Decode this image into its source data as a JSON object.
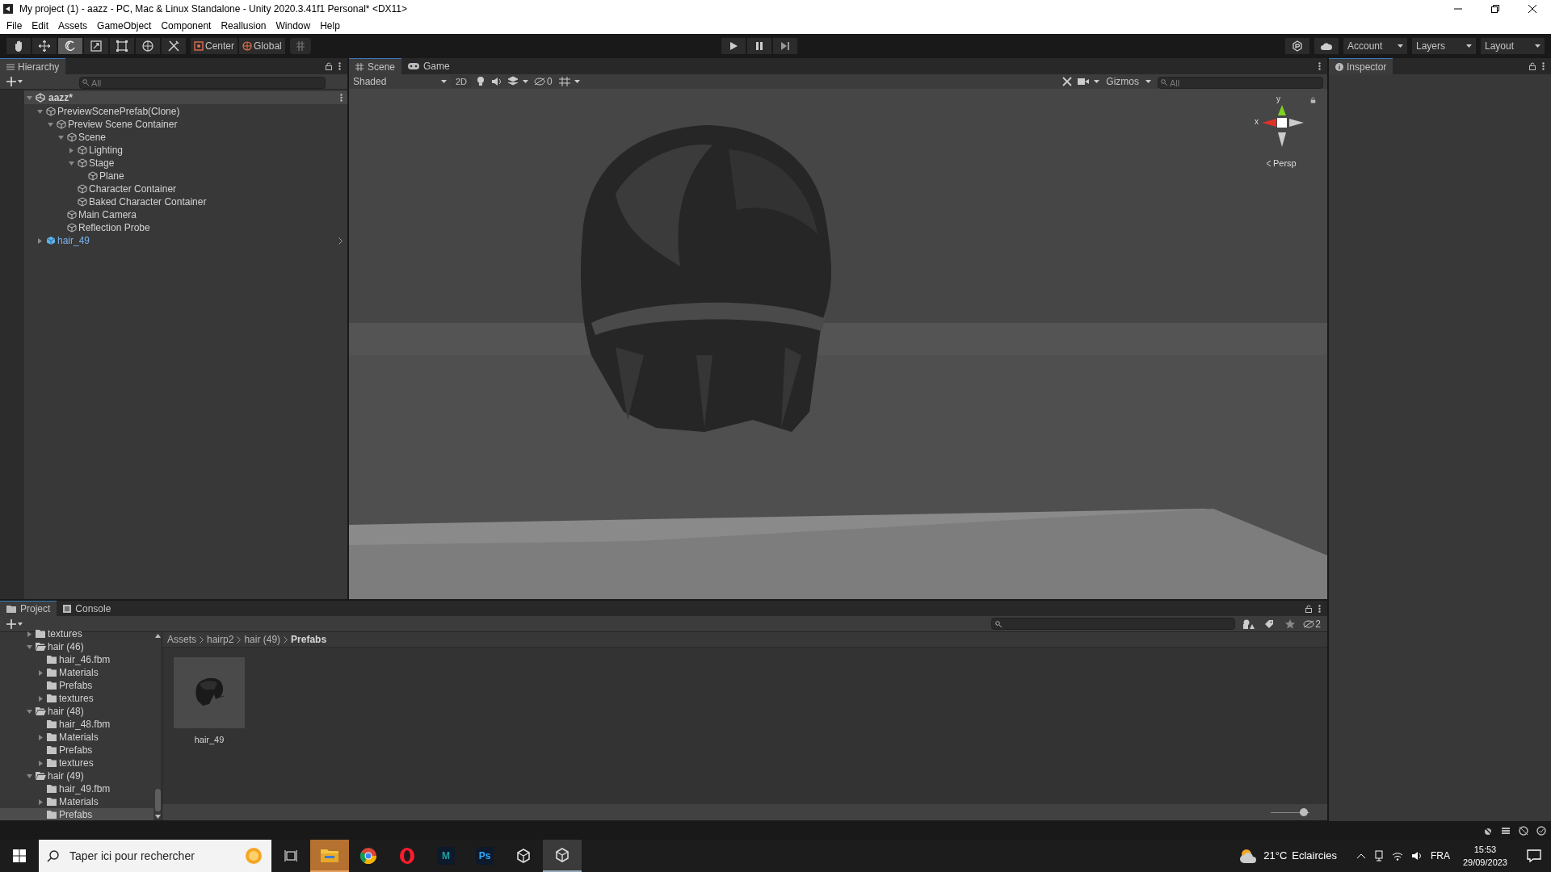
{
  "window": {
    "title": "My project (1) - aazz - PC, Mac & Linux Standalone - Unity 2020.3.41f1 Personal* <DX11>"
  },
  "menu": [
    "File",
    "Edit",
    "Assets",
    "GameObject",
    "Component",
    "Reallusion",
    "Window",
    "Help"
  ],
  "toolbar": {
    "tools": [
      {
        "kind": "hand",
        "selected": false
      },
      {
        "kind": "move",
        "selected": false
      },
      {
        "kind": "rotate",
        "selected": true
      },
      {
        "kind": "scale",
        "selected": false
      },
      {
        "kind": "rect",
        "selected": false
      },
      {
        "kind": "transform",
        "selected": false
      },
      {
        "kind": "custom",
        "selected": false
      }
    ],
    "pivot": [
      {
        "kind": "center",
        "label": "Center"
      },
      {
        "kind": "global",
        "label": "Global"
      }
    ],
    "right": [
      "Account",
      "Layers",
      "Layout"
    ]
  },
  "hierarchy": {
    "tab": "Hierarchy",
    "search": {
      "placeholder": "All"
    },
    "tree": [
      {
        "kind": "scene",
        "label": "aazz*",
        "expanded": true,
        "children": [
          {
            "kind": "object",
            "label": "PreviewScenePrefab(Clone)",
            "expanded": true,
            "children": [
              {
                "kind": "object",
                "label": "Preview Scene Container",
                "expanded": true,
                "children": [
                  {
                    "kind": "object",
                    "label": "Scene",
                    "expanded": true,
                    "children": [
                      {
                        "kind": "object",
                        "label": "Lighting",
                        "expanded": false
                      },
                      {
                        "kind": "object",
                        "label": "Stage",
                        "expanded": true,
                        "children": [
                          {
                            "kind": "object",
                            "label": "Plane"
                          }
                        ]
                      },
                      {
                        "kind": "object",
                        "label": "Character Container"
                      },
                      {
                        "kind": "object",
                        "label": "Baked Character Container"
                      }
                    ]
                  },
                  {
                    "kind": "object",
                    "label": "Main Camera"
                  },
                  {
                    "kind": "object",
                    "label": "Reflection Probe"
                  }
                ]
              }
            ]
          },
          {
            "kind": "prefab",
            "label": "hair_49",
            "expanded": false
          }
        ]
      }
    ]
  },
  "scene": {
    "tabs": [
      {
        "label": "Scene",
        "kind": "scene",
        "selected": true
      },
      {
        "label": "Game",
        "kind": "game",
        "selected": false
      }
    ],
    "shading": "Shaded",
    "mode_2d": "2D",
    "hidden_count": "0",
    "gizmos": "Gizmos",
    "search": {
      "placeholder": "All"
    },
    "axes": {
      "y": "y",
      "x": "x",
      "projection": "Persp"
    }
  },
  "inspector": {
    "tab": "Inspector"
  },
  "project": {
    "tabs": [
      {
        "label": "Project",
        "kind": "project",
        "selected": true
      },
      {
        "label": "Console",
        "kind": "console",
        "selected": false
      }
    ],
    "tree": [
      {
        "label": "textures",
        "expanded": false,
        "selected": false
      },
      {
        "label": "hair (46)",
        "expanded": true,
        "selected": false,
        "children": [
          {
            "label": "hair_46.fbm",
            "selected": false
          },
          {
            "label": "Materials",
            "expanded": false,
            "selected": false
          },
          {
            "label": "Prefabs",
            "selected": false
          },
          {
            "label": "textures",
            "expanded": false,
            "selected": false
          }
        ]
      },
      {
        "label": "hair (48)",
        "expanded": true,
        "selected": false,
        "children": [
          {
            "label": "hair_48.fbm",
            "selected": false
          },
          {
            "label": "Materials",
            "expanded": false,
            "selected": false
          },
          {
            "label": "Prefabs",
            "selected": false
          },
          {
            "label": "textures",
            "expanded": false,
            "selected": false
          }
        ]
      },
      {
        "label": "hair (49)",
        "expanded": true,
        "selected": false,
        "children": [
          {
            "label": "hair_49.fbm",
            "selected": false
          },
          {
            "label": "Materials",
            "expanded": false,
            "selected": false
          },
          {
            "label": "Prefabs",
            "selected": true
          }
        ]
      }
    ],
    "breadcrumbs": [
      "Assets",
      "hairp2",
      "hair (49)",
      "Prefabs"
    ],
    "assets": [
      {
        "name": "hair_49"
      }
    ],
    "hidden_count": "2",
    "zoom": {
      "level": 0.95
    }
  },
  "taskbar": {
    "search": {
      "placeholder": "Taper ici pour rechercher"
    },
    "apps": [
      {
        "kind": "explorer",
        "active": true
      },
      {
        "kind": "chrome",
        "active": false
      },
      {
        "kind": "opera",
        "active": false
      },
      {
        "kind": "letter",
        "label": "M",
        "color": "#1ba0a0",
        "active": false
      },
      {
        "kind": "letter",
        "label": "Ps",
        "color": "#31a8ff",
        "active": false
      },
      {
        "kind": "unity",
        "active": false
      },
      {
        "kind": "unity",
        "active": true
      }
    ],
    "weather": {
      "temp": "21°C",
      "text": "Eclaircies"
    },
    "lang": "FRA",
    "time": "15:53",
    "date": "29/09/2023"
  }
}
